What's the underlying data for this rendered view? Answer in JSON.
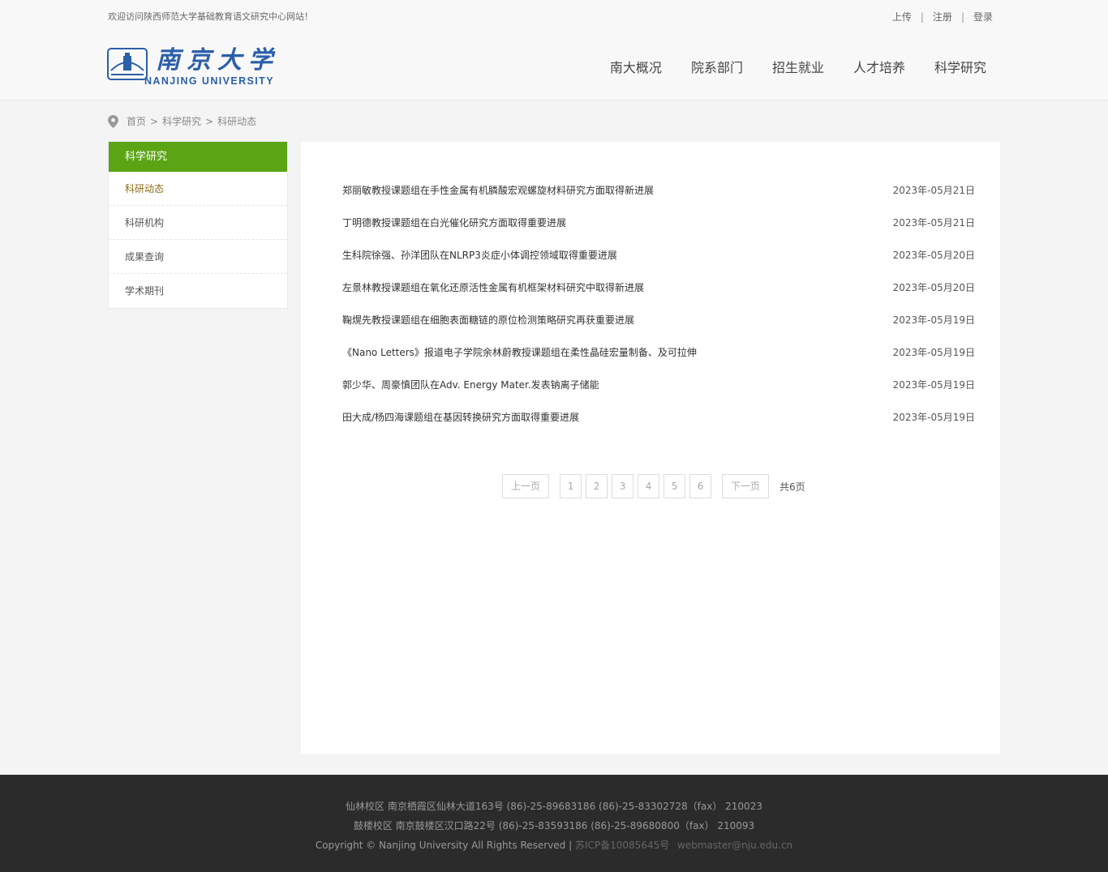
{
  "topbar": {
    "welcome": "欢迎访问陕西师范大学基础教育语文研究中心网站！",
    "links": [
      "上传",
      "注册",
      "登录"
    ]
  },
  "logo": {
    "cn_text": "南京大学",
    "en_text": "NANJING UNIVERSITY"
  },
  "nav": [
    "南大概况",
    "院系部门",
    "招生就业",
    "人才培养",
    "科学研究"
  ],
  "breadcrumb": [
    "首页",
    "科学研究",
    "科研动态"
  ],
  "sidebar": {
    "title": "科学研究",
    "items": [
      "科研动态",
      "科研机构",
      "成果查询",
      "学术期刊"
    ],
    "active_index": 0
  },
  "news": [
    {
      "title": "郑丽敏教授课题组在手性金属有机膦酸宏观螺旋材料研究方面取得新进展",
      "date": "2023年-05月21日"
    },
    {
      "title": "丁明德教授课题组在白光催化研究方面取得重要进展",
      "date": "2023年-05月21日"
    },
    {
      "title": "生科院徐强、孙洋团队在NLRP3炎症小体调控领域取得重要进展",
      "date": "2023年-05月20日"
    },
    {
      "title": "左景林教授课题组在氧化还原活性金属有机框架材料研究中取得新进展",
      "date": "2023年-05月20日"
    },
    {
      "title": "鞠熀先教授课题组在细胞表面糖链的原位检测策略研究再获重要进展",
      "date": "2023年-05月19日"
    },
    {
      "title": "《Nano Letters》报道电子学院余林蔚教授课题组在柔性晶硅宏量制备、及可拉伸",
      "date": "2023年-05月19日"
    },
    {
      "title": "郭少华、周豪慎团队在Adv. Energy Mater.发表钠离子储能",
      "date": "2023年-05月19日"
    },
    {
      "title": "田大成/杨四海课题组在基因转换研究方面取得重要进展",
      "date": "2023年-05月19日"
    }
  ],
  "pager": {
    "prev": "上一页",
    "pages": [
      "1",
      "2",
      "3",
      "4",
      "5",
      "6"
    ],
    "next": "下一页",
    "total": "共6页"
  },
  "footer": {
    "line1": "仙林校区 南京栖霞区仙林大道163号 (86)-25-89683186 (86)-25-83302728（fax） 210023",
    "line2": "鼓楼校区 南京鼓楼区汉口路22号 (86)-25-83593186 (86)-25-89680800（fax） 210093",
    "copyright": "Copyright © Nanjing University All Rights Reserved |",
    "icp": "苏ICP备10085645号",
    "email": "webmaster@nju.edu.cn"
  },
  "colors": {
    "accent_green": "#5ba515",
    "logo_blue": "#2b5fa8",
    "footer_bg": "#2b2b2b"
  }
}
